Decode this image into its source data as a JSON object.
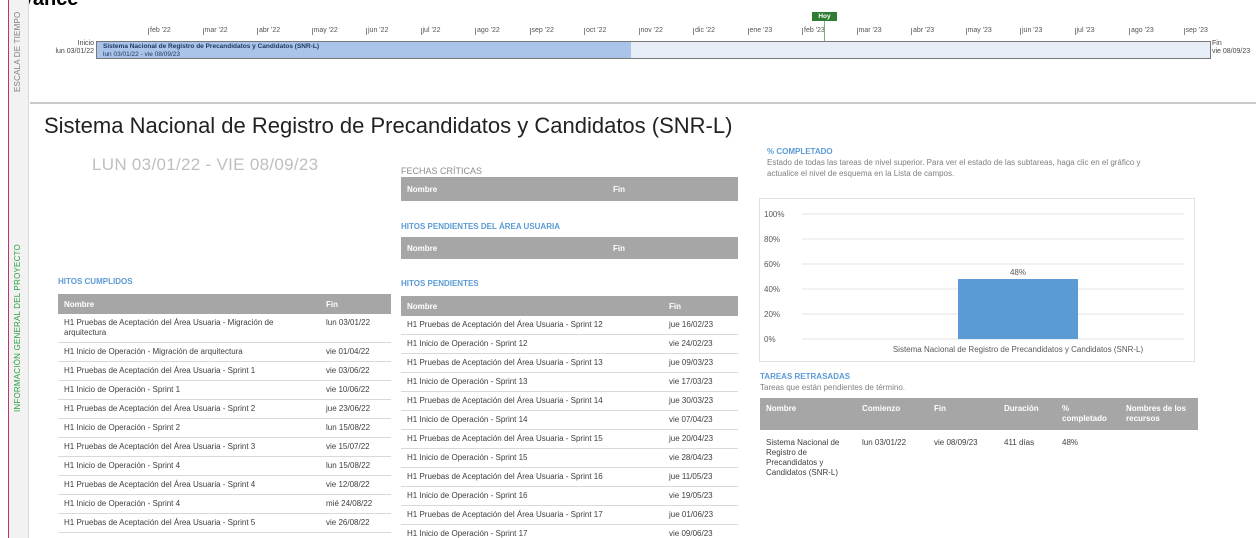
{
  "page": {
    "title": "Avance"
  },
  "side_labels": {
    "timeline": "ESCALA DE TIEMPO",
    "overview": "INFORMACIÓN GENERAL DEL PROYECTO"
  },
  "timeline": {
    "months": [
      "feb '22",
      "mar '22",
      "abr '22",
      "may '22",
      "jun '22",
      "jul '22",
      "ago '22",
      "sep '22",
      "oct '22",
      "nov '22",
      "dic '22",
      "ene '23",
      "feb '23",
      "mar '23",
      "abr '23",
      "may '23",
      "jun '23",
      "jul '23",
      "ago '23",
      "sep '23"
    ],
    "today_label": "Hoy",
    "start_label": "Inicio",
    "start_date": "lun 03/01/22",
    "end_label": "Fin",
    "end_date": "vie 08/09/23",
    "task_name": "Sistema Nacional de Registro de Precandidatos y Candidatos (SNR-L)",
    "task_dates": "lun 03/01/22 - vie 08/09/23",
    "progress": 0.48
  },
  "report": {
    "title": "Sistema Nacional de Registro de Precandidatos y Candidatos (SNR-L)",
    "dates": "LUN 03/01/22  -  VIE 08/09/23"
  },
  "fechas_criticas": {
    "title": "FECHAS CRÍTICAS",
    "col_name": "Nombre",
    "col_end": "Fin"
  },
  "hitos_usuaria": {
    "title": "HITOS PENDIENTES DEL ÁREA USUARIA",
    "col_name": "Nombre",
    "col_end": "Fin"
  },
  "hitos_cumplidos": {
    "title": "HITOS CUMPLIDOS",
    "col_name": "Nombre",
    "col_end": "Fin",
    "rows": [
      [
        "H1 Pruebas de Aceptación del Área Usuaria - Migración de arquitectura",
        "lun 03/01/22"
      ],
      [
        "H1 Inicio de Operación -  Migración de arquitectura",
        "vie 01/04/22"
      ],
      [
        "H1 Pruebas de Aceptación del Área Usuaria - Sprint 1",
        "vie 03/06/22"
      ],
      [
        "H1 Inicio de Operación - Sprint 1",
        "vie 10/06/22"
      ],
      [
        "H1 Pruebas de Aceptación del Área Usuaria - Sprint 2",
        "jue 23/06/22"
      ],
      [
        "H1 Inicio de Operación - Sprint 2",
        "lun 15/08/22"
      ],
      [
        "H1 Pruebas de Aceptación del Área Usuaria - Sprint 3",
        "vie 15/07/22"
      ],
      [
        "H1 Inicio de Operación - Sprint 4",
        "lun 15/08/22"
      ],
      [
        "H1 Pruebas de Aceptación del Área Usuaria - Sprint 4",
        "vie 12/08/22"
      ],
      [
        "H1 Inicio de Operación - Sprint 4",
        "mié 24/08/22"
      ],
      [
        "H1 Pruebas de Aceptación del Área Usuaria - Sprint 5",
        "vie 26/08/22"
      ]
    ]
  },
  "hitos_pendientes": {
    "title": "HITOS PENDIENTES",
    "col_name": "Nombre",
    "col_end": "Fin",
    "rows": [
      [
        "H1 Pruebas de Aceptación del Área Usuaria - Sprint 12",
        "jue 16/02/23"
      ],
      [
        "H1 Inicio de Operación - Sprint 12",
        "vie 24/02/23"
      ],
      [
        "H1 Pruebas de Aceptación del Área Usuaria - Sprint 13",
        "jue 09/03/23"
      ],
      [
        "H1 Inicio de Operación - Sprint 13",
        "vie 17/03/23"
      ],
      [
        "H1 Pruebas de Aceptación del Área Usuaria - Sprint 14",
        "jue 30/03/23"
      ],
      [
        "H1 Inicio de Operación - Sprint 14",
        "vie 07/04/23"
      ],
      [
        "H1 Pruebas de Aceptación del Área Usuaria - Sprint 15",
        "jue 20/04/23"
      ],
      [
        "H1 Inicio de Operación - Sprint 15",
        "vie 28/04/23"
      ],
      [
        "H1 Pruebas de Aceptación del Área Usuaria - Sprint 16",
        "jue 11/05/23"
      ],
      [
        "H1 Inicio de Operación - Sprint 16",
        "vie 19/05/23"
      ],
      [
        "H1 Pruebas de Aceptación del Área Usuaria - Sprint 17",
        "jue 01/06/23"
      ],
      [
        "H1 Inicio de Operación - Sprint 17",
        "vie 09/06/23"
      ]
    ]
  },
  "completado": {
    "title": "% COMPLETADO",
    "desc": "Estado de todas las tareas de nivel superior. Para ver el estado de las subtareas, haga clic en el gráfico y actualice el nivel de esquema en la Lista de campos."
  },
  "chart_data": {
    "type": "bar",
    "categories": [
      "Sistema Nacional de Registro de Precandidatos y Candidatos (SNR-L)"
    ],
    "values": [
      48
    ],
    "data_labels": [
      "48%"
    ],
    "yticks": [
      "0%",
      "20%",
      "40%",
      "60%",
      "80%",
      "100%"
    ],
    "ylim": [
      0,
      100
    ],
    "grid": true,
    "bar_color": "#5b9bd5"
  },
  "retrasadas": {
    "title": "TAREAS RETRASADAS",
    "desc": "Tareas que están pendientes de término.",
    "headers": [
      "Nombre",
      "Comienzo",
      "Fin",
      "Duración",
      "% completado",
      "Nombres de los recursos"
    ],
    "rows": [
      [
        "Sistema Nacional de Registro de Precandidatos y Candidatos (SNR-L)",
        "lun 03/01/22",
        "vie 08/09/23",
        "411 días",
        "48%",
        ""
      ]
    ]
  },
  "colors": {
    "accent": "#5b9bd5",
    "header_gray": "#a6a6a6",
    "today_green": "#2e7d32",
    "side_border": "#c0336a"
  }
}
